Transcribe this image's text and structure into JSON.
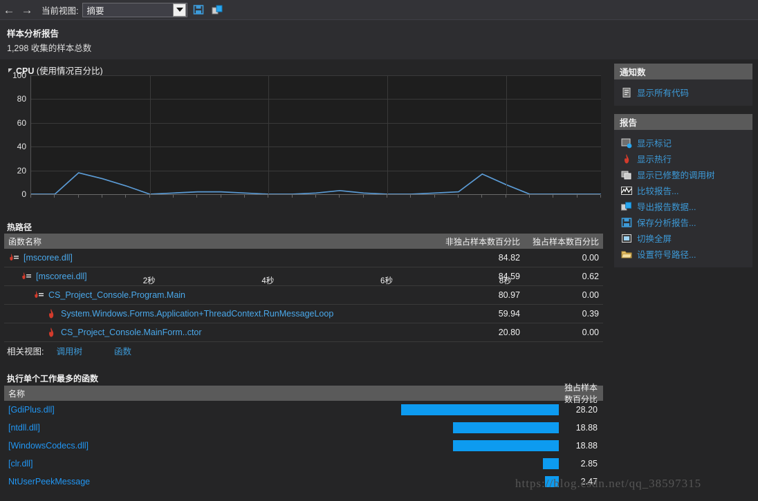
{
  "toolbar": {
    "back_icon": "back-arrow-icon",
    "forward_icon": "forward-arrow-icon",
    "view_label": "当前视图:",
    "view_value": "摘要",
    "save_icon": "save-icon",
    "export_icon": "export-icon"
  },
  "report": {
    "title": "样本分析报告",
    "subtitle": "1,298 收集的样本总数"
  },
  "chart_panel": {
    "title_bold": "CPU",
    "title_rest": " (使用情况百分比)"
  },
  "chart_data": {
    "type": "line",
    "title": "CPU (使用情况百分比)",
    "xlabel": "",
    "ylabel": "",
    "ylim": [
      0,
      100
    ],
    "yticks": [
      0,
      20,
      40,
      60,
      80,
      100
    ],
    "xticks": [
      2,
      4,
      6,
      8
    ],
    "xtick_labels": [
      "2秒",
      "4秒",
      "6秒",
      "8秒"
    ],
    "xlim": [
      0,
      9.6
    ],
    "grid": true,
    "legend": "none",
    "line_color": "#5b9bd5",
    "series": [
      {
        "name": "CPU",
        "x": [
          0.0,
          0.4,
          0.8,
          1.2,
          1.6,
          2.0,
          2.4,
          2.8,
          3.2,
          3.6,
          4.0,
          4.4,
          4.8,
          5.2,
          5.6,
          6.0,
          6.4,
          6.8,
          7.2,
          7.6,
          8.0,
          8.4,
          8.8,
          9.2,
          9.6
        ],
        "values": [
          0,
          0,
          18,
          13,
          7,
          0,
          1,
          2,
          2,
          1,
          0,
          0,
          1,
          3,
          1,
          0,
          0,
          1,
          2,
          17,
          8,
          0,
          0,
          0,
          0
        ]
      }
    ]
  },
  "hotpath": {
    "title": "热路径",
    "columns": [
      "函数名称",
      "非独占样本数百分比",
      "独占样本数百分比"
    ],
    "rows": [
      {
        "icon": "flame-dll-icon",
        "indent": 0,
        "name": "[mscoree.dll]",
        "inclusive": "84.82",
        "exclusive": "0.00"
      },
      {
        "icon": "flame-dll-icon",
        "indent": 1,
        "name": "[mscoreei.dll]",
        "inclusive": "84.59",
        "exclusive": "0.62"
      },
      {
        "icon": "flame-dll-icon",
        "indent": 2,
        "name": "CS_Project_Console.Program.Main",
        "inclusive": "80.97",
        "exclusive": "0.00"
      },
      {
        "icon": "flame-icon",
        "indent": 3,
        "name": "System.Windows.Forms.Application+ThreadContext.RunMessageLoop",
        "inclusive": "59.94",
        "exclusive": "0.39"
      },
      {
        "icon": "flame-icon",
        "indent": 3,
        "name": "CS_Project_Console.MainForm..ctor",
        "inclusive": "20.80",
        "exclusive": "0.00"
      }
    ]
  },
  "related_views": {
    "label": "相关视图:",
    "links": [
      "调用树",
      "函数"
    ]
  },
  "functions": {
    "title": "执行单个工作最多的函数",
    "columns": [
      "名称",
      "独占样本数百分比"
    ],
    "max_value": 28.2,
    "rows": [
      {
        "name": "[GdiPlus.dll]",
        "value": "28.20",
        "pct": 28.2
      },
      {
        "name": "[ntdll.dll]",
        "value": "18.88",
        "pct": 18.88
      },
      {
        "name": "[WindowsCodecs.dll]",
        "value": "18.88",
        "pct": 18.88
      },
      {
        "name": "[clr.dll]",
        "value": "2.85",
        "pct": 2.85
      },
      {
        "name": "NtUserPeekMessage",
        "value": "2.47",
        "pct": 2.47
      }
    ]
  },
  "sidebar": {
    "panels": [
      {
        "title": "通知数",
        "items": [
          {
            "icon": "document-icon",
            "label": "显示所有代码"
          }
        ]
      },
      {
        "title": "报告",
        "items": [
          {
            "icon": "marks-icon",
            "label": "显示标记"
          },
          {
            "icon": "flame-icon",
            "label": "显示热行"
          },
          {
            "icon": "calltree-icon",
            "label": "显示已修整的调用树"
          },
          {
            "icon": "compare-icon",
            "label": "比较报告..."
          },
          {
            "icon": "export-icon",
            "label": "导出报告数据..."
          },
          {
            "icon": "save-icon",
            "label": "保存分析报告..."
          },
          {
            "icon": "fullscreen-icon",
            "label": "切换全屏"
          },
          {
            "icon": "folder-icon",
            "label": "设置符号路径..."
          }
        ]
      }
    ]
  },
  "watermark": {
    "text": "https://blog.csdn.net/qq_38597315"
  },
  "colors": {
    "background": "#252526",
    "panel_header": "#5a5a5a",
    "link": "#3d9ad8",
    "bar": "#0d9bf0",
    "chart_line": "#5b9bd5"
  }
}
